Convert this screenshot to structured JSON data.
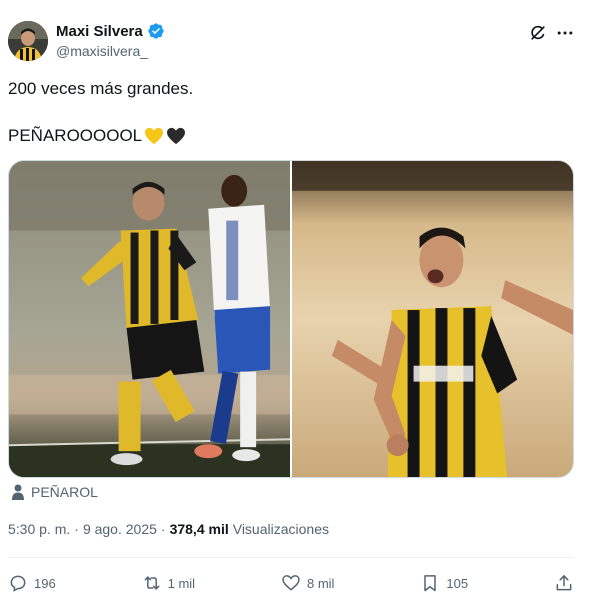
{
  "author": {
    "name": "Maxi Silvera",
    "handle": "@maxisilvera_"
  },
  "tweet": {
    "line1": "200 veces más grandes.",
    "line2": "PEÑAROOOOOL",
    "emojis": [
      "yellow-heart",
      "black-heart"
    ]
  },
  "media": {
    "photos": [
      {
        "alt": "Jugador de Peñarol celebrando un gol"
      },
      {
        "alt": "Jugador de Peñarol gritando el gol"
      }
    ]
  },
  "location": {
    "label": "PEÑAROL"
  },
  "meta": {
    "time": "5:30 p. m.",
    "separator1": "·",
    "date": "9 ago. 2025",
    "separator2": "·",
    "views_count": "378,4 mil",
    "views_label": "Visualizaciones"
  },
  "actions": {
    "replies": "196",
    "reposts": "1 mil",
    "likes": "8 mil",
    "bookmarks": "105"
  },
  "colors": {
    "verified": "#1d9bf0",
    "text_secondary": "#536471",
    "yellow_heart": "#f5c518",
    "black_heart": "#2b2b2b"
  }
}
